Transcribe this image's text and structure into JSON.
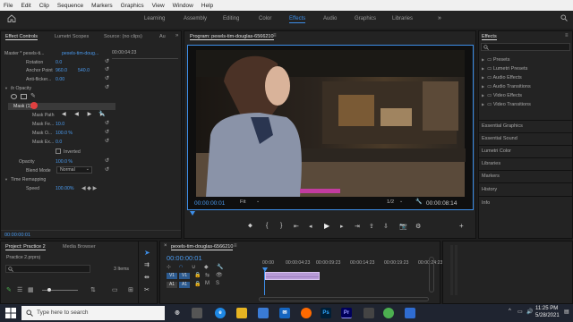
{
  "menu": [
    "File",
    "Edit",
    "Clip",
    "Sequence",
    "Markers",
    "Graphics",
    "View",
    "Window",
    "Help"
  ],
  "workspaces": {
    "items": [
      "Learning",
      "Assembly",
      "Editing",
      "Color",
      "Effects",
      "Audio",
      "Graphics",
      "Libraries"
    ],
    "active": "Effects"
  },
  "effect_controls": {
    "tabs": [
      "Effect Controls",
      "Lumetri Scopes",
      "Source: (no clips)",
      "Au"
    ],
    "master": "Master * pexels-ti...",
    "clip": "pexels-tim-doug...",
    "timecode_small": "00:00:04:23",
    "rotation_label": "Rotation",
    "rotation_value": "0.0",
    "anchor_label": "Anchor Point",
    "anchor_x": "960.0",
    "anchor_y": "540.0",
    "anti_flicker_label": "Anti-flicker...",
    "anti_flicker_value": "0.00",
    "opacity_label": "Opacity",
    "mask_label": "Mask (1)",
    "mask_path_label": "Mask Path",
    "mask_feather_label": "Mask Fe...",
    "mask_feather_value": "10.0",
    "mask_opacity_label": "Mask O...",
    "mask_opacity_value": "100.0 %",
    "mask_expansion_label": "Mask Ex...",
    "mask_expansion_value": "0.0",
    "inverted_label": "Inverted",
    "opacity2_label": "Opacity",
    "opacity2_value": "100.0 %",
    "blend_label": "Blend Mode",
    "blend_value": "Normal",
    "time_remap_label": "Time Remapping",
    "speed_label": "Speed",
    "speed_value": "100.00%",
    "footer_timecode": "00:00:00:01"
  },
  "program": {
    "tab": "Program: pexels-tim-douglas-6566210",
    "timecode": "00:00:00:01",
    "fit": "Fit",
    "quality": "1/2",
    "duration": "00:00:08:14"
  },
  "effects": {
    "title": "Effects",
    "folders": [
      "Presets",
      "Lumetri Presets",
      "Audio Effects",
      "Audio Transitions",
      "Video Effects",
      "Video Transitions"
    ],
    "panels": [
      "Essential Graphics",
      "Essential Sound",
      "Lumetri Color",
      "Libraries",
      "Markers",
      "History",
      "Info"
    ]
  },
  "project": {
    "tabs": [
      "Project: Practice 2",
      "Media Browser"
    ],
    "file": "Practice 2.prproj",
    "items": "3 Items"
  },
  "timeline": {
    "title": "pexels-tim-douglas-6566210",
    "timecode": "00:00:00:01",
    "ruler": [
      "00:00",
      "00:00:04:23",
      "00:00:09:23",
      "00:00:14:23",
      "00:00:19:23",
      "00:00:24:23"
    ],
    "tracks": [
      "V1",
      "V1",
      "A1",
      "A1"
    ]
  },
  "taskbar": {
    "search_placeholder": "Type here to search",
    "time": "11:25 PM",
    "date": "5/28/2021",
    "apps": [
      "Ps",
      "Pr"
    ]
  }
}
